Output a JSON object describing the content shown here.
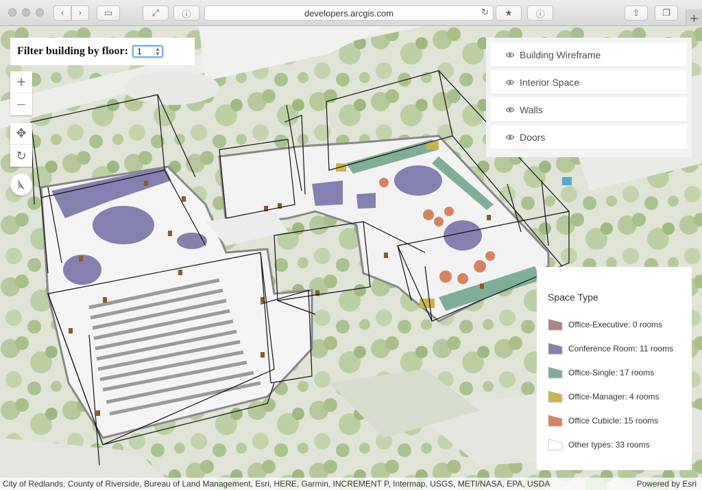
{
  "browser": {
    "url": "developers.arcgis.com",
    "reload_glyph": "↻",
    "new_tab_glyph": "+",
    "buttons": [
      {
        "name": "back-button",
        "glyph": "‹",
        "icon": "chevron-left-icon"
      },
      {
        "name": "forward-button",
        "glyph": "›",
        "icon": "chevron-right-icon"
      },
      {
        "name": "sidebar-button",
        "glyph": "▭",
        "icon": "sidebar-icon"
      },
      {
        "name": "expand-button",
        "glyph": "⤢",
        "icon": "expand-icon"
      },
      {
        "name": "reader-button",
        "glyph": "ⓘ",
        "icon": "info-icon"
      },
      {
        "name": "bookmark-button",
        "glyph": "★",
        "icon": "bookmark-icon"
      },
      {
        "name": "info-button",
        "glyph": "ⓘ",
        "icon": "info-icon"
      },
      {
        "name": "share-button",
        "glyph": "⇪",
        "icon": "share-icon"
      },
      {
        "name": "tabs-button",
        "glyph": "❐",
        "icon": "tabs-icon"
      }
    ]
  },
  "floor_filter": {
    "label": "Filter building by floor:",
    "value": "1"
  },
  "zoom": {
    "in": "+",
    "out": "—"
  },
  "nav": {
    "pan": "✥",
    "rotate": "↻"
  },
  "layers": {
    "items": [
      {
        "label": "Building Wireframe"
      },
      {
        "label": "Interior Space"
      },
      {
        "label": "Walls"
      },
      {
        "label": "Doors"
      }
    ]
  },
  "legend": {
    "title": "Space Type",
    "items": [
      {
        "label": "Office-Executive: 0 rooms",
        "color": "#b0847f"
      },
      {
        "label": "Conference Room: 11 rooms",
        "color": "#8480b0"
      },
      {
        "label": "Office-Single: 17 rooms",
        "color": "#7fae98"
      },
      {
        "label": "Office-Manager: 4 rooms",
        "color": "#cbb44a"
      },
      {
        "label": "Office Cubicle: 15 rooms",
        "color": "#d9825f"
      },
      {
        "label": "Other types: 33 rooms",
        "color": "#ffffff"
      }
    ]
  },
  "attribution": {
    "text": "City of Redlands, County of Riverside, Bureau of Land Management, Esri, HERE, Garmin, INCREMENT P, Intermap, USGS, METI/NASA, EPA, USDA",
    "powered_prefix": "Powered by ",
    "powered_brand": "Esri"
  }
}
